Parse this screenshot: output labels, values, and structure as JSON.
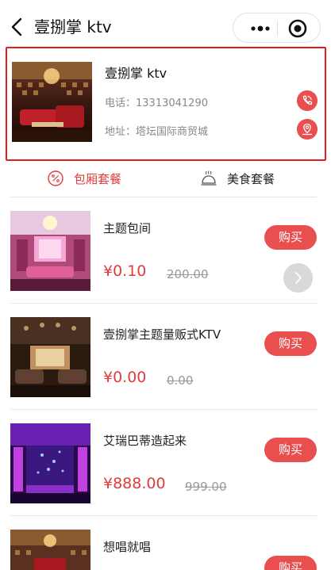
{
  "header": {
    "title": "壹捌掌 ktv",
    "back_icon": "chevron-left-icon",
    "more_icon": "more-dots-icon",
    "capsule_close_icon": "target-circle-icon"
  },
  "store": {
    "name": "壹捌掌 ktv",
    "phone_label": "电话：13313041290",
    "address_label": "地址：塔坛国际商贸城",
    "phone_icon": "phone-icon",
    "location_icon": "location-pin-icon",
    "accent_color": "#ea4f4f",
    "highlight_border_color": "#e02020"
  },
  "tabs": [
    {
      "label": "包厢套餐",
      "icon": "percent-badge-icon",
      "active": true
    },
    {
      "label": "美食套餐",
      "icon": "food-cloche-icon",
      "active": false
    }
  ],
  "products": [
    {
      "name": "主题包间",
      "price": "¥0.10",
      "original_price": "200.00",
      "buy_label": "购买"
    },
    {
      "name": "壹捌掌主题量贩式KTV",
      "price": "¥0.00",
      "original_price": "0.00",
      "buy_label": "购买"
    },
    {
      "name": "艾瑞巴蒂造起来",
      "price": "¥888.00",
      "original_price": "999.00",
      "buy_label": "购买"
    },
    {
      "name": "想唱就唱",
      "price": "",
      "original_price": "",
      "buy_label": "购买"
    }
  ],
  "float_button_icon": "chevron-right-icon",
  "colors": {
    "price_red": "#e23b3b",
    "divider": "#e6e6e6"
  }
}
